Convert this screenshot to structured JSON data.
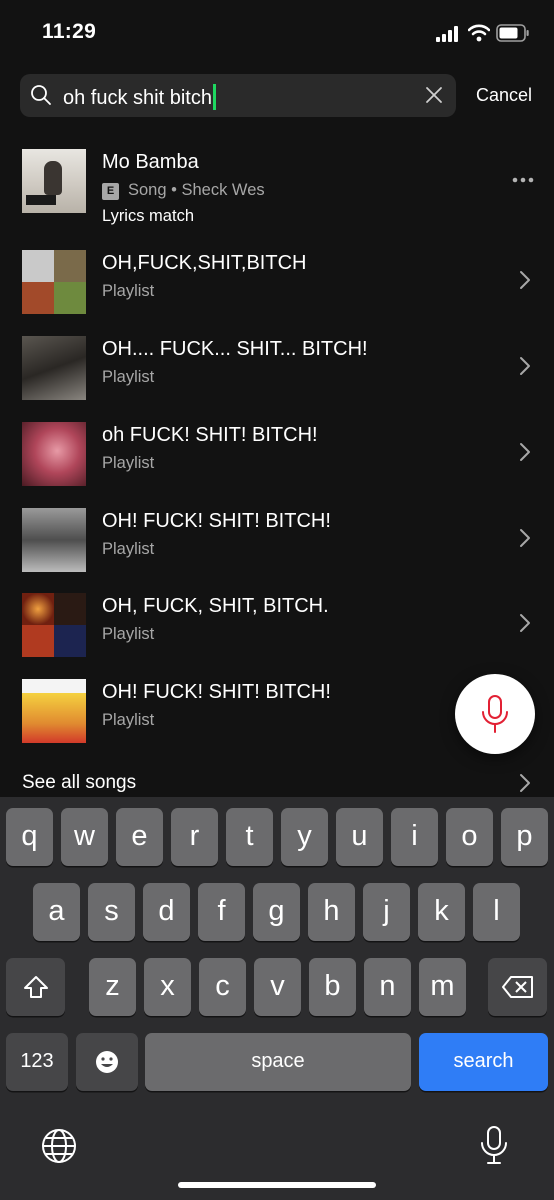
{
  "status_bar": {
    "time": "11:29"
  },
  "search": {
    "query": "oh fuck shit bitch",
    "cancel_label": "Cancel"
  },
  "results": [
    {
      "title": "Mo Bamba",
      "explicit": "E",
      "subtitle": "Song • Sheck Wes",
      "extra": "Lyrics match",
      "action": "more"
    },
    {
      "title": "OH,FUCK,SHIT,BITCH",
      "subtitle": "Playlist",
      "action": "open"
    },
    {
      "title": "OH.... FUCK... SHIT... BITCH!",
      "subtitle": "Playlist",
      "action": "open"
    },
    {
      "title": "oh FUCK! SHIT! BITCH!",
      "subtitle": "Playlist",
      "action": "open"
    },
    {
      "title": "OH! FUCK! SHIT! BITCH!",
      "subtitle": "Playlist",
      "action": "open"
    },
    {
      "title": "OH, FUCK, SHIT, BITCH.",
      "subtitle": "Playlist",
      "action": "open"
    },
    {
      "title": "OH! FUCK! SHIT! BITCH!",
      "subtitle": "Playlist",
      "action": "open"
    }
  ],
  "see_all_label": "See all songs",
  "keyboard": {
    "row1": [
      "q",
      "w",
      "e",
      "r",
      "t",
      "y",
      "u",
      "i",
      "o",
      "p"
    ],
    "row2": [
      "a",
      "s",
      "d",
      "f",
      "g",
      "h",
      "j",
      "k",
      "l"
    ],
    "row3": [
      "z",
      "x",
      "c",
      "v",
      "b",
      "n",
      "m"
    ],
    "numbers_label": "123",
    "space_label": "space",
    "return_label": "search"
  },
  "colors": {
    "background": "#121212",
    "accent": "#1ed760",
    "keyboard_blue": "#2f7df6"
  }
}
